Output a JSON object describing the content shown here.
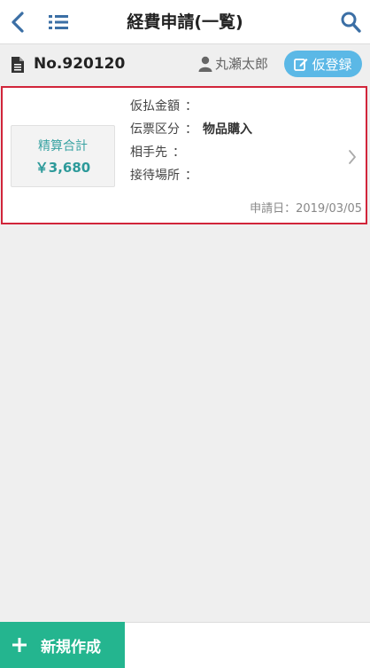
{
  "header": {
    "title": "経費申請(一覧)",
    "back_icon": "chevron-left-icon",
    "menu_icon": "list-icon",
    "search_icon": "search-icon"
  },
  "subbar": {
    "doc_icon": "document-icon",
    "doc_no": "No.920120",
    "user_icon": "user-icon",
    "user_name": "丸瀬太郎",
    "temp_register_label": "仮登録",
    "temp_register_icon": "edit-icon"
  },
  "card": {
    "total_label": "精算合計",
    "total_amount": "￥3,680",
    "fields": [
      {
        "label": "仮払金額",
        "sep": "：",
        "value": ""
      },
      {
        "label": "伝票区分",
        "sep": "：",
        "value": "物品購入"
      },
      {
        "label": "相手先",
        "sep": "：",
        "value": ""
      },
      {
        "label": "接待場所",
        "sep": "：",
        "value": ""
      }
    ],
    "date": "申請日：2019/03/05",
    "chevron_icon": "chevron-right-icon"
  },
  "footer": {
    "new_label": "新規作成",
    "new_icon": "plus-icon"
  },
  "colors": {
    "accent_blue": "#5bb8e6",
    "accent_green": "#24b58f",
    "selected_border": "#d1253a",
    "icon_blue": "#3b6fa5",
    "total_teal": "#2d9a9a"
  }
}
